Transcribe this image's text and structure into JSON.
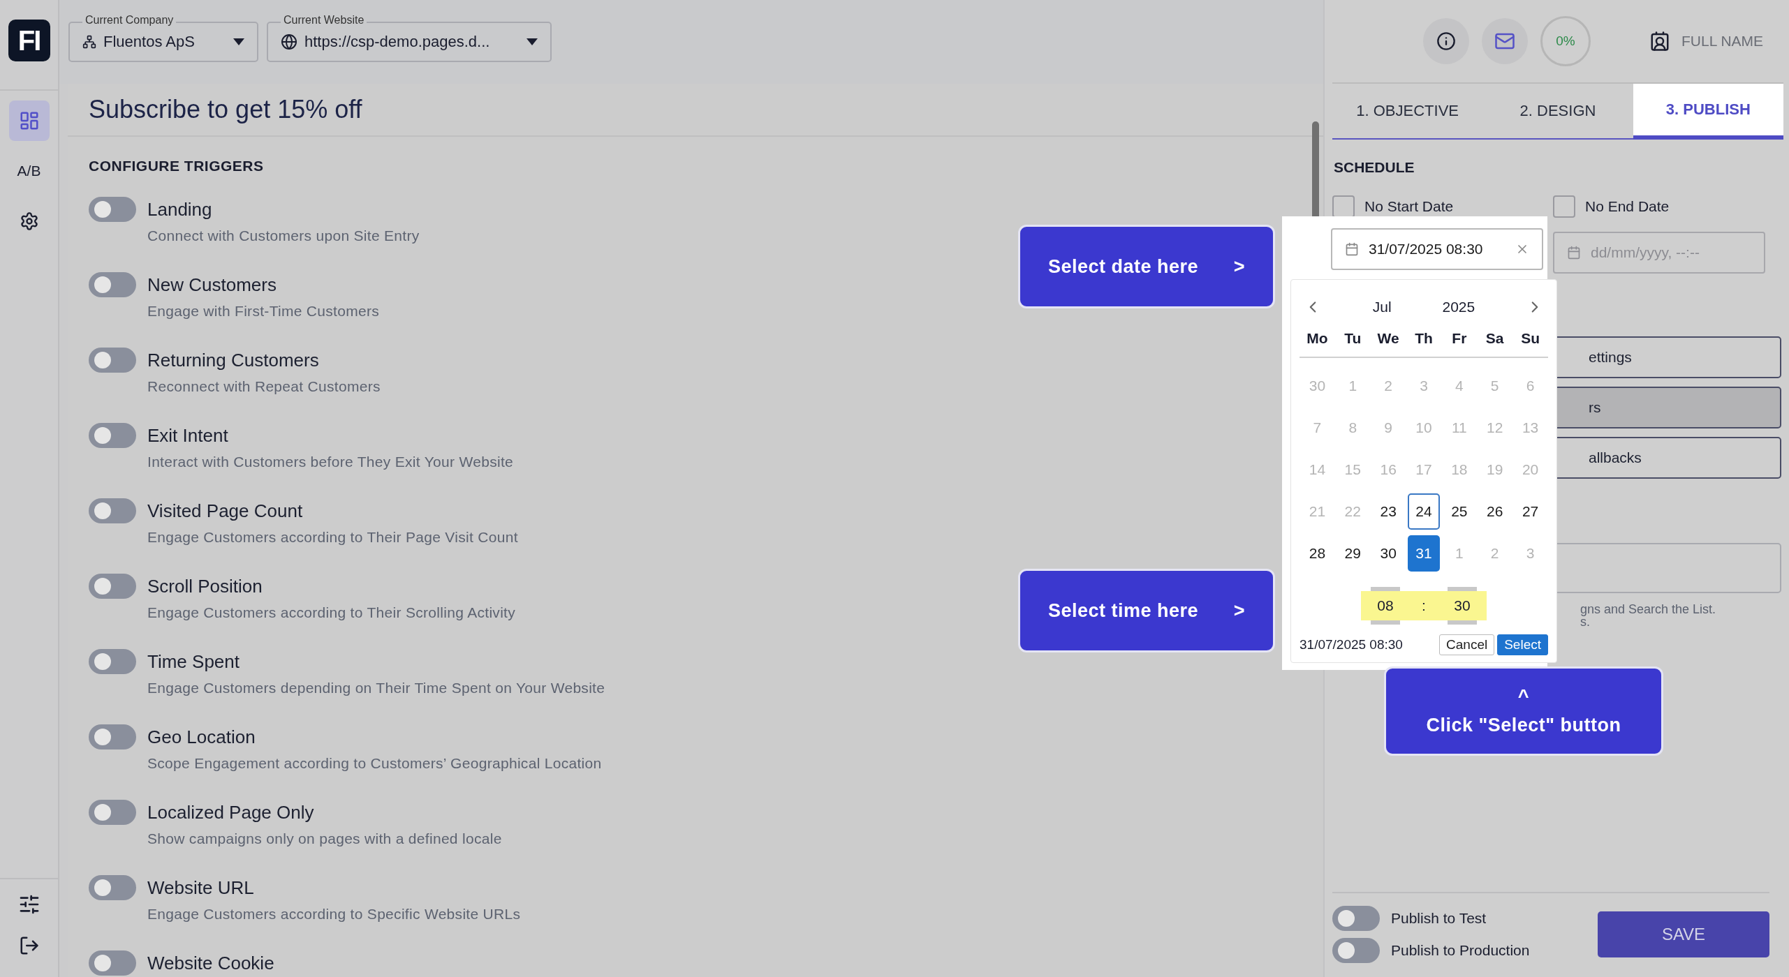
{
  "sidebar": {
    "logo": "FI",
    "items": [
      {
        "kind": "layout",
        "selected": true
      },
      {
        "kind": "text",
        "label": "A/B",
        "selected": false
      },
      {
        "kind": "gear",
        "selected": false
      }
    ]
  },
  "header": {
    "company": {
      "label": "Current Company",
      "value": "Fluentos ApS"
    },
    "website": {
      "label": "Current Website",
      "value": "https://csp-demo.pages.d..."
    }
  },
  "user": {
    "progress": "0%",
    "name": "FULL NAME"
  },
  "campaign": {
    "title": "Subscribe to get 15% off",
    "section": "CONFIGURE TRIGGERS",
    "triggers": [
      {
        "label": "Landing",
        "description": "Connect with Customers upon Site Entry",
        "on": false
      },
      {
        "label": "New Customers",
        "description": "Engage with First-Time Customers",
        "on": false
      },
      {
        "label": "Returning Customers",
        "description": "Reconnect with Repeat Customers",
        "on": false
      },
      {
        "label": "Exit Intent",
        "description": "Interact with Customers before They Exit Your Website",
        "on": false
      },
      {
        "label": "Visited Page Count",
        "description": "Engage Customers according to Their Page Visit Count",
        "on": false
      },
      {
        "label": "Scroll Position",
        "description": "Engage Customers according to Their Scrolling Activity",
        "on": false
      },
      {
        "label": "Time Spent",
        "description": "Engage Customers depending on Their Time Spent on Your Website",
        "on": false
      },
      {
        "label": "Geo Location",
        "description": "Scope Engagement according to Customers’ Geographical Location",
        "on": false
      },
      {
        "label": "Localized Page Only",
        "description": "Show campaigns only on pages with a defined locale",
        "on": false
      },
      {
        "label": "Website URL",
        "description": "Engage Customers according to Specific Website URLs",
        "on": false
      },
      {
        "label": "Website Cookie",
        "on": false
      }
    ]
  },
  "tabs": [
    {
      "label": "1. OBJECTIVE",
      "selected": false
    },
    {
      "label": "2. DESIGN",
      "selected": false
    },
    {
      "label": "3. PUBLISH",
      "selected": true
    }
  ],
  "schedule": {
    "title": "SCHEDULE",
    "checkboxes": [
      {
        "label": "No Start Date",
        "checked": false
      },
      {
        "label": "No End Date",
        "checked": false
      }
    ],
    "start_date": "31/07/2025 08:30",
    "end_date_placeholder": "dd/mm/yyyy, --:--"
  },
  "datepicker": {
    "month": "Jul",
    "year": "2025",
    "weekdays": [
      "Mo",
      "Tu",
      "We",
      "Th",
      "Fr",
      "Sa",
      "Su"
    ],
    "days": [
      {
        "label": "30",
        "muted": true,
        "today": false,
        "selected": false
      },
      {
        "label": "1",
        "muted": true,
        "today": false,
        "selected": false
      },
      {
        "label": "2",
        "muted": true,
        "today": false,
        "selected": false
      },
      {
        "label": "3",
        "muted": true,
        "today": false,
        "selected": false
      },
      {
        "label": "4",
        "muted": true,
        "today": false,
        "selected": false
      },
      {
        "label": "5",
        "muted": true,
        "today": false,
        "selected": false
      },
      {
        "label": "6",
        "muted": true,
        "today": false,
        "selected": false
      },
      {
        "label": "7",
        "muted": true,
        "today": false,
        "selected": false
      },
      {
        "label": "8",
        "muted": true,
        "today": false,
        "selected": false
      },
      {
        "label": "9",
        "muted": true,
        "today": false,
        "selected": false
      },
      {
        "label": "10",
        "muted": true,
        "today": false,
        "selected": false
      },
      {
        "label": "11",
        "muted": true,
        "today": false,
        "selected": false
      },
      {
        "label": "12",
        "muted": true,
        "today": false,
        "selected": false
      },
      {
        "label": "13",
        "muted": true,
        "today": false,
        "selected": false
      },
      {
        "label": "14",
        "muted": true,
        "today": false,
        "selected": false
      },
      {
        "label": "15",
        "muted": true,
        "today": false,
        "selected": false
      },
      {
        "label": "16",
        "muted": true,
        "today": false,
        "selected": false
      },
      {
        "label": "17",
        "muted": true,
        "today": false,
        "selected": false
      },
      {
        "label": "18",
        "muted": true,
        "today": false,
        "selected": false
      },
      {
        "label": "19",
        "muted": true,
        "today": false,
        "selected": false
      },
      {
        "label": "20",
        "muted": true,
        "today": false,
        "selected": false
      },
      {
        "label": "21",
        "muted": true,
        "today": false,
        "selected": false
      },
      {
        "label": "22",
        "muted": true,
        "today": false,
        "selected": false
      },
      {
        "label": "23",
        "muted": false,
        "today": false,
        "selected": false
      },
      {
        "label": "24",
        "muted": false,
        "today": true,
        "selected": false
      },
      {
        "label": "25",
        "muted": false,
        "today": false,
        "selected": false
      },
      {
        "label": "26",
        "muted": false,
        "today": false,
        "selected": false
      },
      {
        "label": "27",
        "muted": false,
        "today": false,
        "selected": false
      },
      {
        "label": "28",
        "muted": false,
        "today": false,
        "selected": false
      },
      {
        "label": "29",
        "muted": false,
        "today": false,
        "selected": false
      },
      {
        "label": "30",
        "muted": false,
        "today": false,
        "selected": false
      },
      {
        "label": "31",
        "muted": false,
        "today": false,
        "selected": true
      },
      {
        "label": "1",
        "muted": true,
        "today": false,
        "selected": false
      },
      {
        "label": "2",
        "muted": true,
        "today": false,
        "selected": false
      },
      {
        "label": "3",
        "muted": true,
        "today": false,
        "selected": false
      }
    ],
    "hours": "08",
    "separator": ":",
    "minutes": "30",
    "value": "31/07/2025 08:30",
    "cancel": "Cancel",
    "select": "Select"
  },
  "settings_buttons": [
    {
      "label": "ettings",
      "hovered": false
    },
    {
      "label": "rs",
      "hovered": true
    },
    {
      "label": "allbacks",
      "hovered": false
    }
  ],
  "hint_lines": [
    "gns and Search the List.",
    "s."
  ],
  "publish": {
    "toggles": [
      {
        "label": "Publish to Test",
        "on": false
      },
      {
        "label": "Publish to Production",
        "on": false
      }
    ],
    "save": "SAVE"
  },
  "callouts": [
    {
      "text": "Select date here",
      "arrow": ">",
      "kind": "side"
    },
    {
      "text": "Select time here",
      "arrow": ">",
      "kind": "side"
    },
    {
      "text": "Click \"Select\" button",
      "arrow": "^",
      "kind": "top"
    }
  ]
}
